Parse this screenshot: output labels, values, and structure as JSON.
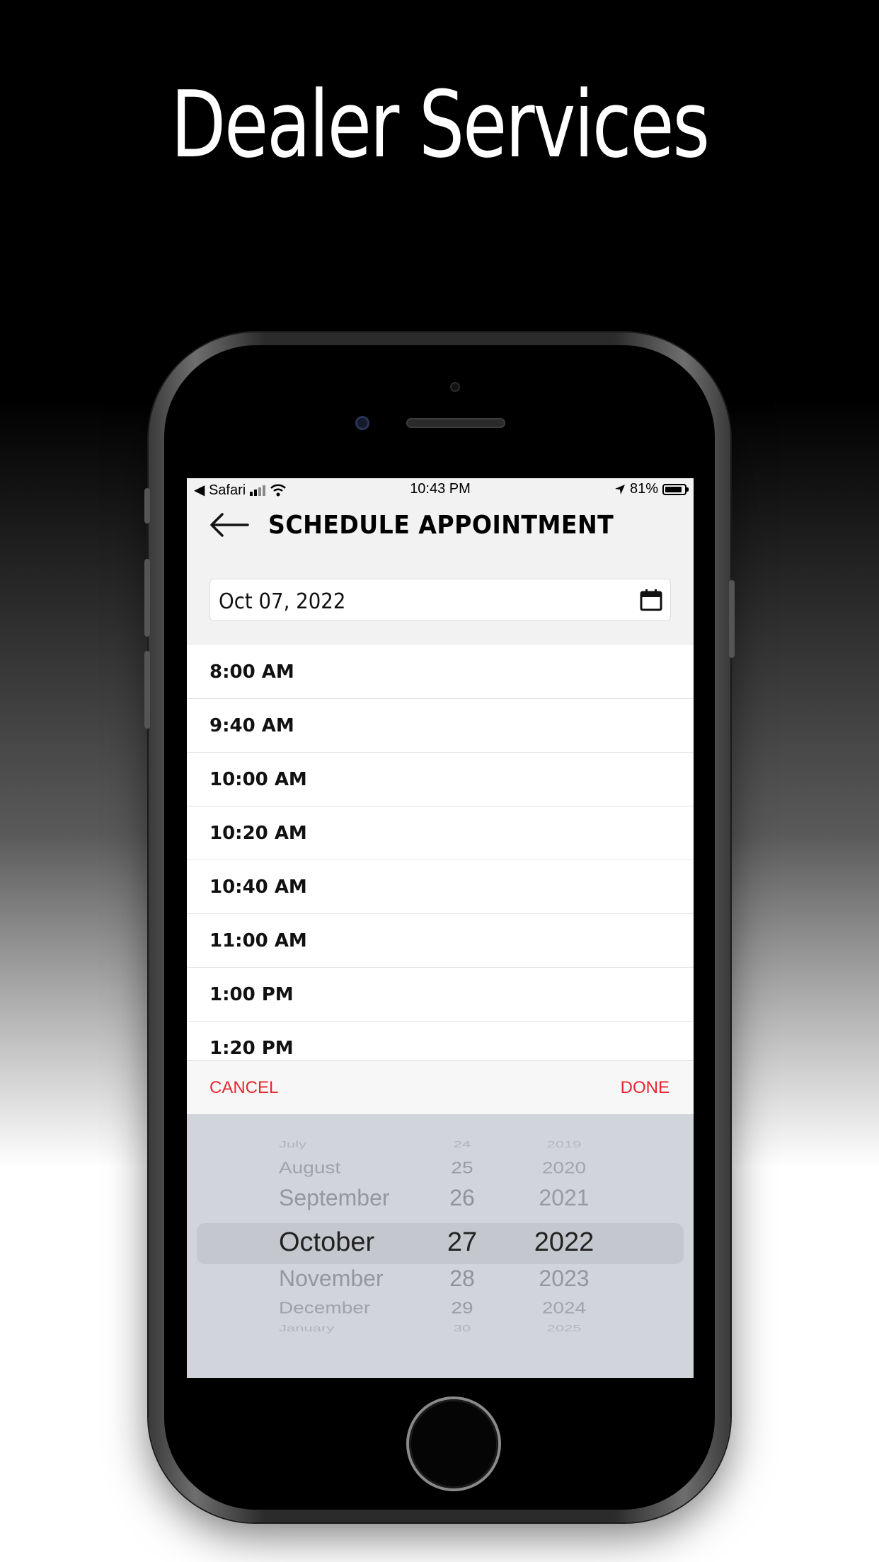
{
  "headline": "Dealer Services",
  "status_bar": {
    "carrier": "◀ Safari",
    "time": "10:43 PM",
    "battery_percent": "81%"
  },
  "header": {
    "title": "SCHEDULE APPOINTMENT"
  },
  "date_field": {
    "value": "Oct 07, 2022"
  },
  "time_slots": [
    "8:00 AM",
    "9:40 AM",
    "10:00 AM",
    "10:20 AM",
    "10:40 AM",
    "11:00 AM",
    "1:00 PM",
    "1:20 PM"
  ],
  "toolbar": {
    "cancel_label": "CANCEL",
    "done_label": "DONE"
  },
  "picker": {
    "months": [
      "July",
      "August",
      "September",
      "October",
      "November",
      "December",
      "January"
    ],
    "days": [
      "24",
      "25",
      "26",
      "27",
      "28",
      "29",
      "30"
    ],
    "years": [
      "2019",
      "2020",
      "2021",
      "2022",
      "2023",
      "2024",
      "2025"
    ],
    "selected": {
      "month": "October",
      "day": "27",
      "year": "2022"
    }
  },
  "colors": {
    "accent": "#e8262f",
    "picker_bg": "#d1d4da",
    "screen_bg": "#f2f2f2"
  }
}
